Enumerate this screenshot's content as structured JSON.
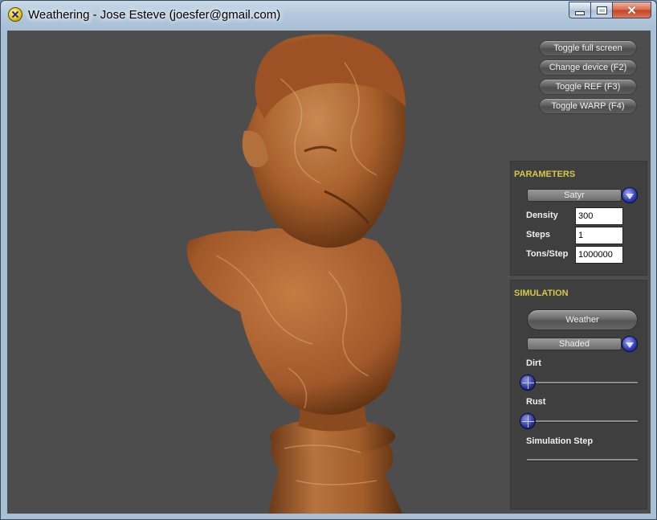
{
  "window": {
    "title": "Weathering - Jose Esteve (joesfer@gmail.com)",
    "controls": {
      "minimize": "minimize",
      "maximize": "maximize",
      "close": "✕"
    }
  },
  "toolbar": {
    "toggle_full_screen": "Toggle full screen",
    "change_device": "Change device (F2)",
    "toggle_ref": "Toggle REF (F3)",
    "toggle_warp": "Toggle WARP (F4)"
  },
  "parameters": {
    "title": "PARAMETERS",
    "model": "Satyr",
    "density_label": "Density",
    "density_value": "300",
    "steps_label": "Steps",
    "steps_value": "1",
    "tons_label": "Tons/Step",
    "tons_value": "1000000"
  },
  "simulation": {
    "title": "SIMULATION",
    "weather_button": "Weather",
    "shading_mode": "Shaded",
    "dirt_label": "Dirt",
    "dirt_level": 0,
    "rust_label": "Rust",
    "rust_level": 0,
    "sim_step_label": "Simulation Step"
  },
  "colors": {
    "viewport_bg": "#4d4d4d",
    "panel_bg": "#3f3f3f",
    "panel_title": "#d6c84a",
    "bust": "#b56a33"
  },
  "icons": {
    "app": "app-icon",
    "dropdown": "chevron-down-icon",
    "slider": "slider-thumb-icon"
  }
}
